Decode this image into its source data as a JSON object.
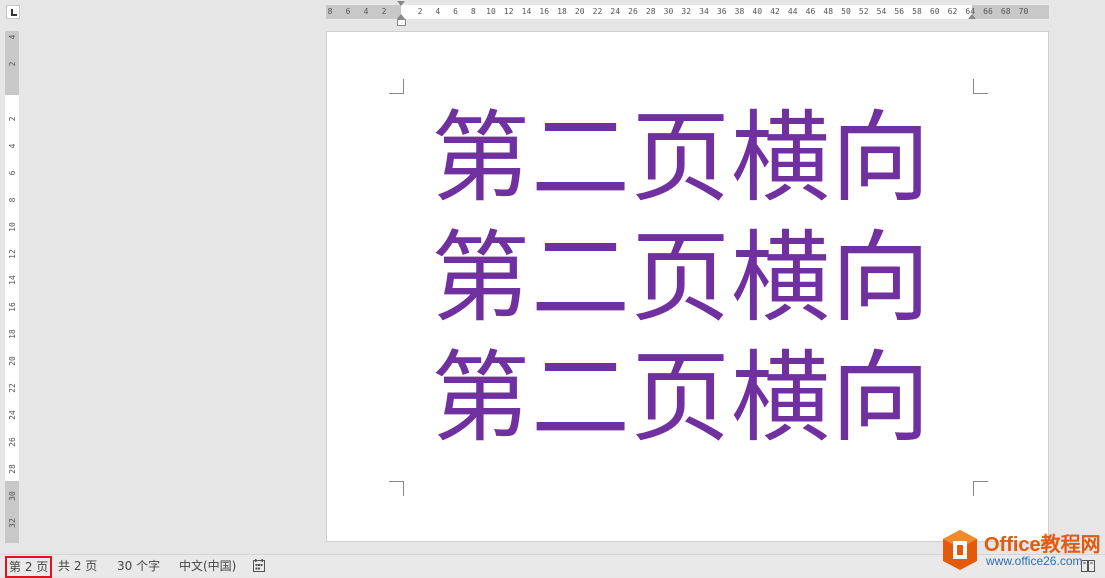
{
  "ruler": {
    "horizontal_ticks": [
      "8",
      "6",
      "4",
      "2",
      "2",
      "4",
      "6",
      "8",
      "10",
      "12",
      "14",
      "16",
      "18",
      "20",
      "22",
      "24",
      "26",
      "28",
      "30",
      "32",
      "34",
      "36",
      "38",
      "40",
      "42",
      "44",
      "46",
      "48",
      "50",
      "52",
      "54",
      "56",
      "58",
      "60",
      "62",
      "64",
      "66",
      "68",
      "70"
    ],
    "vertical_ticks": [
      "4",
      "2",
      "2",
      "4",
      "6",
      "8",
      "10",
      "12",
      "14",
      "16",
      "18",
      "20",
      "22",
      "24",
      "26",
      "28",
      "30",
      "32"
    ]
  },
  "document": {
    "lines": [
      "第二页横向",
      "第二页横向",
      "第二页横向"
    ],
    "text_color": "#7030a0"
  },
  "status_bar": {
    "page": "第 2 页",
    "total": "共 2 页",
    "words": "30 个字",
    "language": "中文(中国)",
    "highlight_color": "#e0141e"
  },
  "watermark": {
    "title": "Office教程网",
    "url": "www.office26.com"
  }
}
